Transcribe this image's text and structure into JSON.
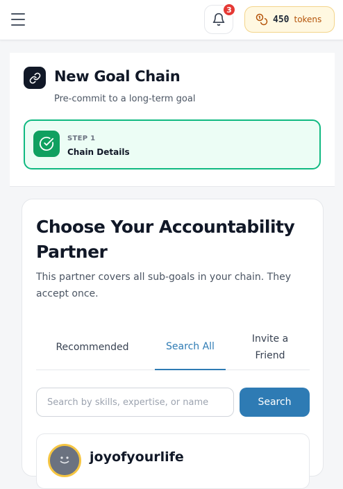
{
  "header": {
    "notifications_count": "3",
    "tokens_count": "450",
    "tokens_label": "tokens"
  },
  "goal": {
    "title": "New Goal Chain",
    "subtitle": "Pre-commit to a long-term goal"
  },
  "step": {
    "number": "STEP 1",
    "name": "Chain Details"
  },
  "partner": {
    "title": "Choose Your Accountability Partner",
    "description": "This partner covers all sub-goals in your chain. They accept once.",
    "tabs": [
      {
        "label": "Recommended"
      },
      {
        "label": "Search All"
      },
      {
        "label": "Invite a Friend"
      }
    ],
    "active_tab": "Search All",
    "search_placeholder": "Search by skills, expertise, or name",
    "search_button": "Search",
    "results": [
      {
        "name": "joyofyourlife"
      }
    ]
  },
  "colors": {
    "accent": "#2e7bb4",
    "success": "#10b981",
    "badge": "#e53935",
    "tokens_bg": "#fff8e1"
  }
}
